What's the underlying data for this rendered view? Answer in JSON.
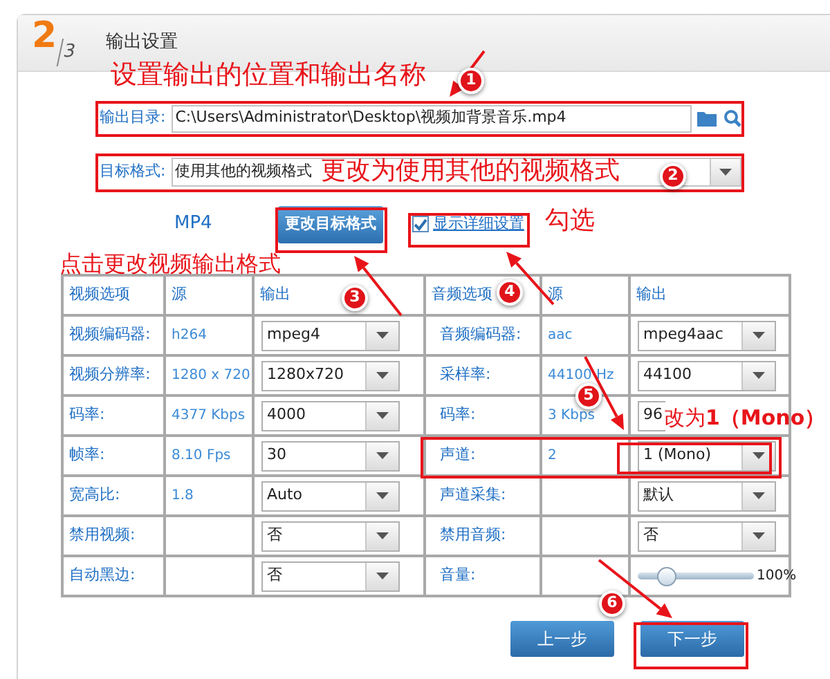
{
  "header": {
    "step": "2",
    "total": "3",
    "title": "输出设置"
  },
  "output_dir": {
    "label": "输出目录:",
    "value": "C:\\Users\\Administrator\\Desktop\\视频加背景音乐.mp4"
  },
  "target_format": {
    "label": "目标格式:",
    "value": "使用其他的视频格式"
  },
  "format_name": "MP4",
  "change_format_button": "更改目标格式",
  "show_details": {
    "label": "显示详细设置",
    "checked": true
  },
  "video_table": {
    "columns": [
      "视频选项",
      "源",
      "输出"
    ],
    "rows": [
      {
        "label": "视频编码器:",
        "source": "h264",
        "output": "mpeg4"
      },
      {
        "label": "视频分辨率:",
        "source": "1280 x 720",
        "output": "1280x720"
      },
      {
        "label": "码率:",
        "source": "4377 Kbps",
        "output": "4000"
      },
      {
        "label": "帧率:",
        "source": "8.10 Fps",
        "output": "30"
      },
      {
        "label": "宽高比:",
        "source": "1.8",
        "output": "Auto"
      },
      {
        "label": "禁用视频:",
        "output": "否"
      },
      {
        "label": "自动黑边:",
        "output": "否"
      }
    ]
  },
  "audio_table": {
    "columns": [
      "音频选项",
      "源",
      "输出"
    ],
    "rows": [
      {
        "kind": "select",
        "label": "音频编码器:",
        "source": "aac",
        "output": "mpeg4aac"
      },
      {
        "kind": "select",
        "label": "采样率:",
        "source": "44100 Hz",
        "output": "44100"
      },
      {
        "kind": "select",
        "label": "码率:",
        "source": "3 Kbps",
        "output": "96"
      },
      {
        "kind": "select",
        "label": "声道:",
        "source": "2",
        "output": "1 (Mono)"
      },
      {
        "kind": "select",
        "label": "声道采集:",
        "output": "默认"
      },
      {
        "kind": "select",
        "label": "禁用音频:",
        "output": "否"
      },
      {
        "kind": "slider",
        "label": "音量:",
        "level": 0.2,
        "reading": "100%"
      }
    ]
  },
  "buttons": [
    {
      "label": "上一步"
    },
    {
      "label": "下一步"
    }
  ],
  "annotations": {
    "notes": [
      "设置输出的位置和输出名称",
      "更改为使用其他的视频格式",
      "勾选",
      "点击更改视频输出格式",
      "改为**1（Mono）**"
    ],
    "badges": [
      "1",
      "2",
      "3",
      "4",
      "5",
      "6"
    ]
  }
}
